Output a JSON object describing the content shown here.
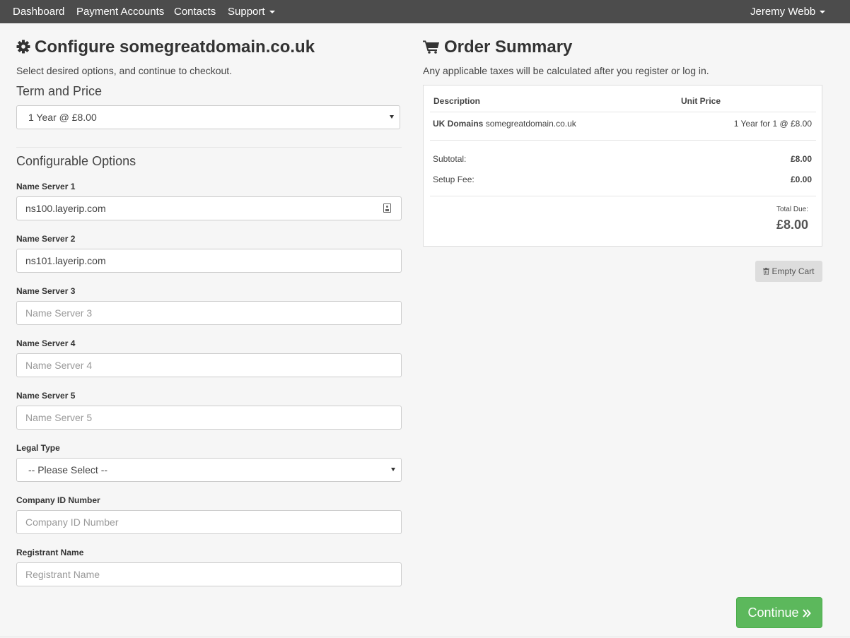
{
  "nav": {
    "items": [
      "Dashboard",
      "Payment Accounts",
      "Contacts",
      "Support"
    ],
    "user": "Jeremy Webb"
  },
  "configure": {
    "title": "Configure somegreatdomain.co.uk",
    "subtitle": "Select desired options, and continue to checkout.",
    "term_heading": "Term and Price",
    "term_value": "1 Year @ £8.00",
    "options_heading": "Configurable Options",
    "fields": [
      {
        "label": "Name Server 1",
        "value": "ns100.layerip.com",
        "placeholder": ""
      },
      {
        "label": "Name Server 2",
        "value": "ns101.layerip.com",
        "placeholder": ""
      },
      {
        "label": "Name Server 3",
        "value": "",
        "placeholder": "Name Server 3"
      },
      {
        "label": "Name Server 4",
        "value": "",
        "placeholder": "Name Server 4"
      },
      {
        "label": "Name Server 5",
        "value": "",
        "placeholder": "Name Server 5"
      }
    ],
    "legal_type": {
      "label": "Legal Type",
      "value": "-- Please Select --"
    },
    "company_id": {
      "label": "Company ID Number",
      "placeholder": "Company ID Number"
    },
    "registrant": {
      "label": "Registrant Name",
      "placeholder": "Registrant Name"
    }
  },
  "summary": {
    "title": "Order Summary",
    "subtitle": "Any applicable taxes will be calculated after you register or log in.",
    "col_description": "Description",
    "col_unit_price": "Unit Price",
    "item_product": "UK Domains",
    "item_domain": "somegreatdomain.co.uk",
    "item_price": "1 Year for 1 @ £8.00",
    "subtotal_label": "Subtotal:",
    "subtotal_value": "£8.00",
    "setup_label": "Setup Fee:",
    "setup_value": "£0.00",
    "total_label": "Total Due:",
    "total_value": "£8.00",
    "empty_cart": "Empty Cart",
    "continue": "Continue"
  },
  "colors": {
    "navbar": "#4c4c4c",
    "continue_button": "#5cb85c",
    "empty_cart_button": "#dddddd"
  },
  "icons": [
    "gear-icon",
    "cart-icon",
    "vcard-icon",
    "trash-icon",
    "double-chevron-right-icon",
    "caret-down-icon"
  ]
}
